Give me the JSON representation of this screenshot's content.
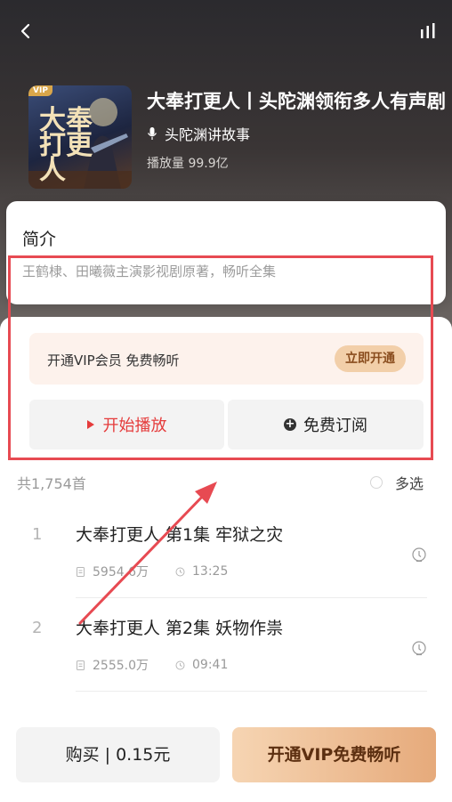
{
  "header": {
    "back_icon": "chevron-left-icon",
    "chart_icon": "bar-chart-icon"
  },
  "album": {
    "cover_badge": "VIP",
    "cover_title": "大奉打更人",
    "title": "大奉打更人丨头陀渊领衔多人有声剧",
    "author": "头陀渊讲故事",
    "plays": "播放量 99.9亿"
  },
  "intro": {
    "label": "简介",
    "text": "王鹤棣、田曦薇主演影视剧原著，畅听全集"
  },
  "vip_banner": {
    "text": "开通VIP会员 免费畅听",
    "button": "立即开通"
  },
  "actions": {
    "play": "开始播放",
    "subscribe": "免费订阅"
  },
  "list": {
    "count": "共1,754首",
    "multi_select": "多选"
  },
  "episodes": [
    {
      "index": "1",
      "title": "大奉打更人 第1集 牢狱之灾",
      "plays": "5954.6万",
      "duration": "13:25"
    },
    {
      "index": "2",
      "title": "大奉打更人 第2集 妖物作祟",
      "plays": "2555.0万",
      "duration": "09:41"
    }
  ],
  "bottom": {
    "buy": "购买 | 0.15元",
    "vip": "开通VIP免费畅听"
  },
  "colors": {
    "accent_red": "#e53b3b",
    "annotation_red": "#e74a52",
    "vip_gold": "#e6aa7b"
  }
}
